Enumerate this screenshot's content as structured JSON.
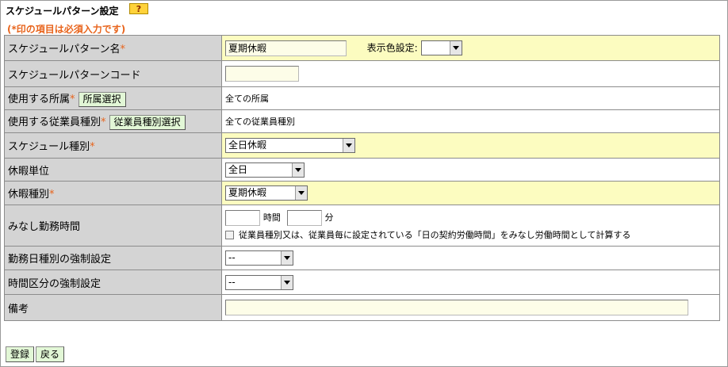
{
  "header": {
    "title": "スケジュールパターン設定",
    "help_label": "?",
    "required_note": "(*印の項目は必須入力です)"
  },
  "form": {
    "required_mark": "*",
    "pattern_name": {
      "label": "スケジュールパターン名",
      "value": "夏期休暇",
      "color_label": "表示色設定:",
      "color_value": ""
    },
    "pattern_code": {
      "label": "スケジュールパターンコード",
      "value": ""
    },
    "department": {
      "label": "使用する所属",
      "button": "所属選択",
      "value": "全ての所属"
    },
    "employee_type": {
      "label": "使用する従業員種別",
      "button": "従業員種別選択",
      "value": "全ての従業員種別"
    },
    "schedule_type": {
      "label": "スケジュール種別",
      "value": "全日休暇"
    },
    "leave_unit": {
      "label": "休暇単位",
      "value": "全日"
    },
    "leave_type": {
      "label": "休暇種別",
      "value": "夏期休暇"
    },
    "deemed_hours": {
      "label": "みなし勤務時間",
      "hours_value": "",
      "hours_unit": "時間",
      "minutes_value": "",
      "minutes_unit": "分",
      "checkbox_label": "従業員種別又は、従業員毎に設定されている「日の契約労働時間」をみなし労働時間として計算する"
    },
    "workday_force": {
      "label": "勤務日種別の強制設定",
      "value": "--"
    },
    "timeslot_force": {
      "label": "時間区分の強制設定",
      "value": "--"
    },
    "remarks": {
      "label": "備考",
      "value": ""
    }
  },
  "actions": {
    "register": "登録",
    "back": "戻る"
  },
  "colors": {
    "highlight_row": "#fcfcc0",
    "label_bg": "#d4d4d4",
    "required": "#e8641c",
    "help": "#ffd23a",
    "button_bg": "#e2f7d6"
  }
}
